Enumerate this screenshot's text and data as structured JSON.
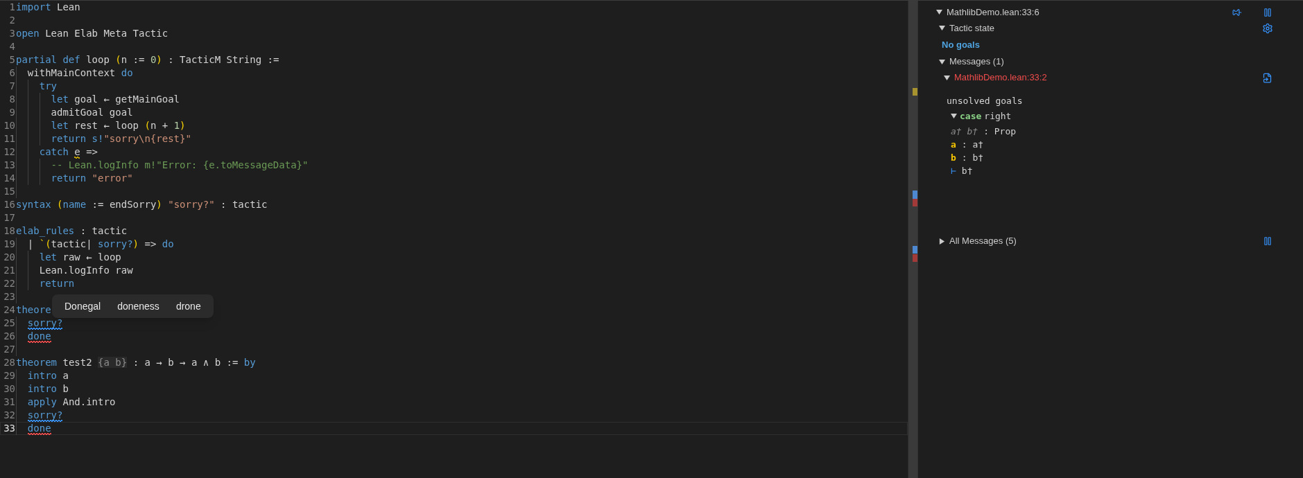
{
  "editor": {
    "lines": [
      {
        "number": "1",
        "current": false,
        "tokens": [
          {
            "text": "import",
            "kind": "kw"
          },
          {
            "text": " Lean",
            "kind": "id"
          }
        ]
      },
      {
        "number": "2",
        "current": false
      },
      {
        "number": "3",
        "current": false,
        "tokens": [
          {
            "text": "open",
            "kind": "kw"
          },
          {
            "text": " Lean Elab Meta Tactic",
            "kind": "id"
          }
        ]
      },
      {
        "number": "4",
        "current": false
      },
      {
        "number": "5",
        "current": false,
        "tokens": [
          {
            "text": "partial def",
            "kind": "kw"
          },
          {
            "text": " loop ",
            "kind": "id"
          },
          {
            "text": "(",
            "kind": "bracket"
          },
          {
            "text": "n := ",
            "kind": "id"
          },
          {
            "text": "0",
            "kind": "num"
          },
          {
            "text": ")",
            "kind": "bracket"
          },
          {
            "text": " : TacticM String :=",
            "kind": "id"
          }
        ]
      },
      {
        "number": "6",
        "current": false,
        "tokens": [
          {
            "text": "  withMainContext ",
            "kind": "id"
          },
          {
            "text": "do",
            "kind": "kw"
          }
        ]
      },
      {
        "number": "7",
        "current": false,
        "tokens": [
          {
            "text": "    try",
            "kind": "kw"
          }
        ]
      },
      {
        "number": "8",
        "current": false,
        "tokens": [
          {
            "text": "      let",
            "kind": "kw"
          },
          {
            "text": " goal ← getMainGoal",
            "kind": "id"
          }
        ]
      },
      {
        "number": "9",
        "current": false,
        "tokens": [
          {
            "text": "      admitGoal goal",
            "kind": "id"
          }
        ]
      },
      {
        "number": "10",
        "current": false,
        "tokens": [
          {
            "text": "      let",
            "kind": "kw"
          },
          {
            "text": " rest ← loop ",
            "kind": "id"
          },
          {
            "text": "(",
            "kind": "bracket"
          },
          {
            "text": "n + ",
            "kind": "id"
          },
          {
            "text": "1",
            "kind": "num"
          },
          {
            "text": ")",
            "kind": "bracket"
          }
        ]
      },
      {
        "number": "11",
        "current": false,
        "tokens": [
          {
            "text": "      return s!",
            "kind": "kw"
          },
          {
            "text": "\"sorry\\n{rest}\"",
            "kind": "str"
          }
        ]
      },
      {
        "number": "12",
        "current": false,
        "tokens": [
          {
            "text": "    catch ",
            "kind": "kw"
          },
          {
            "text": "e",
            "kind": "id",
            "underline": {
              "color": "#cca700"
            }
          },
          {
            "text": " =>",
            "kind": "id"
          }
        ]
      },
      {
        "number": "13",
        "current": false,
        "tokens": [
          {
            "text": "      -- Lean.logInfo m!\"Error: {e.toMessageData}\"",
            "kind": "comment"
          }
        ]
      },
      {
        "number": "14",
        "current": false,
        "tokens": [
          {
            "text": "      return ",
            "kind": "kw"
          },
          {
            "text": "\"error\"",
            "kind": "str"
          }
        ]
      },
      {
        "number": "15",
        "current": false
      },
      {
        "number": "16",
        "current": false,
        "tokens": [
          {
            "text": "syntax ",
            "kind": "kw"
          },
          {
            "text": "(",
            "kind": "bracket"
          },
          {
            "text": "name",
            "kind": "kw"
          },
          {
            "text": " := endSorry",
            "kind": "id"
          },
          {
            "text": ")",
            "kind": "bracket"
          },
          {
            "text": " \"sorry?\"",
            "kind": "str"
          },
          {
            "text": " : tactic",
            "kind": "id"
          }
        ]
      },
      {
        "number": "17",
        "current": false
      },
      {
        "number": "18",
        "current": false,
        "tokens": [
          {
            "text": "elab_rules",
            "kind": "kw"
          },
          {
            "text": " : tactic",
            "kind": "id"
          }
        ]
      },
      {
        "number": "19",
        "current": false,
        "tokens": [
          {
            "text": "  | ",
            "kind": "id"
          },
          {
            "text": "`(",
            "kind": "bracket"
          },
          {
            "text": "tactic| ",
            "kind": "id"
          },
          {
            "text": "sorry?",
            "kind": "kw"
          },
          {
            "text": ")",
            "kind": "bracket"
          },
          {
            "text": " => ",
            "kind": "id"
          },
          {
            "text": "do",
            "kind": "kw"
          }
        ]
      },
      {
        "number": "20",
        "current": false,
        "tokens": [
          {
            "text": "    let",
            "kind": "kw"
          },
          {
            "text": " raw ← loop",
            "kind": "id"
          }
        ]
      },
      {
        "number": "21",
        "current": false,
        "tokens": [
          {
            "text": "    Lean.logInfo raw",
            "kind": "id"
          }
        ]
      },
      {
        "number": "22",
        "current": false,
        "tokens": [
          {
            "text": "    return",
            "kind": "kw"
          }
        ]
      },
      {
        "number": "23",
        "current": false
      },
      {
        "number": "24",
        "current": false,
        "tokens": [
          {
            "text": "theore",
            "kind": "kw"
          }
        ]
      },
      {
        "number": "25",
        "current": false,
        "tokens": [
          {
            "text": "  sorry?",
            "kind": "kw",
            "underline": {
              "color": "#3794ff"
            }
          }
        ]
      },
      {
        "number": "26",
        "current": false,
        "tokens": [
          {
            "text": "  done",
            "kind": "kw",
            "underline": {
              "color": "#f14c4c"
            }
          }
        ]
      },
      {
        "number": "27",
        "current": false
      },
      {
        "number": "28",
        "current": false,
        "tokens": [
          {
            "text": "theorem",
            "kind": "kw"
          },
          {
            "text": " test2 ",
            "kind": "id"
          },
          {
            "text": "{a b}",
            "kind": "hint"
          },
          {
            "text": " : a → b → a ∧ b := ",
            "kind": "id"
          },
          {
            "text": "by",
            "kind": "kw"
          }
        ]
      },
      {
        "number": "29",
        "current": false,
        "tokens": [
          {
            "text": "  intro",
            "kind": "kw"
          },
          {
            "text": " a",
            "kind": "id"
          }
        ]
      },
      {
        "number": "30",
        "current": false,
        "tokens": [
          {
            "text": "  intro",
            "kind": "kw"
          },
          {
            "text": " b",
            "kind": "id"
          }
        ]
      },
      {
        "number": "31",
        "current": false,
        "tokens": [
          {
            "text": "  apply",
            "kind": "kw"
          },
          {
            "text": " And.intro",
            "kind": "id"
          }
        ]
      },
      {
        "number": "32",
        "current": false,
        "tokens": [
          {
            "text": "  sorry?",
            "kind": "kw",
            "underline": {
              "color": "#3794ff"
            }
          }
        ]
      },
      {
        "number": "33",
        "current": true,
        "tokens": [
          {
            "text": "  done",
            "kind": "kw",
            "underline": {
              "color": "#f14c4c"
            }
          }
        ]
      }
    ],
    "suggestions": [
      "Donegal",
      "doneness",
      "drone"
    ]
  },
  "infoview": {
    "position": {
      "title": "MathlibDemo.lean:33:6",
      "expanded": true
    },
    "tactic_state": {
      "label": "Tactic state",
      "expanded": true,
      "content": "No goals"
    },
    "messages": {
      "label": "Messages (1)",
      "expanded": true,
      "items": [
        {
          "location": "MathlibDemo.lean:33:2",
          "color": "#f14c4c",
          "expanded": true,
          "text": "unsolved goals",
          "goal": {
            "keyword": "case",
            "name": "right",
            "expanded": true,
            "hypotheses": [
              {
                "names": "a† b†",
                "type": ": Prop",
                "kind": "inaccessible"
              },
              {
                "names": "a",
                "type": ": a†",
                "kind": "named"
              },
              {
                "names": "b",
                "type": ": b†",
                "kind": "named"
              }
            ],
            "turnstile": "⊢",
            "target": "b†"
          }
        }
      ]
    },
    "all_messages": {
      "label": "All Messages (5)",
      "expanded": false
    }
  }
}
